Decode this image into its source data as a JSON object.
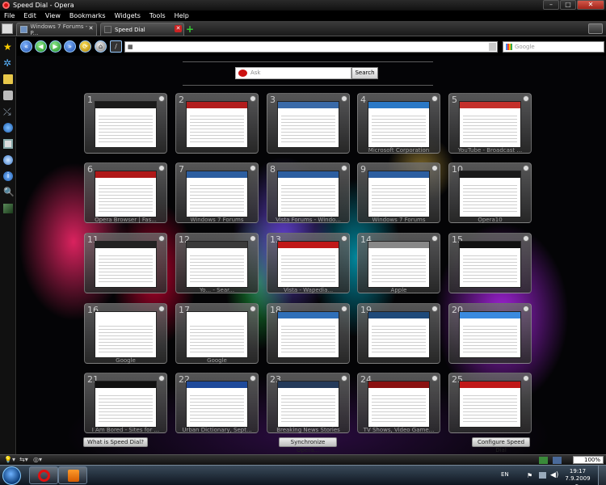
{
  "window": {
    "title": "Speed Dial - Opera"
  },
  "menu": [
    "File",
    "Edit",
    "View",
    "Bookmarks",
    "Widgets",
    "Tools",
    "Help"
  ],
  "tabs": [
    {
      "label": "Windows 7 Forums - P...",
      "active": false
    },
    {
      "label": "Speed Dial",
      "active": true
    }
  ],
  "search": {
    "engine": "Google",
    "placeholder": "Google"
  },
  "speeddial": {
    "search_placeholder": "Ask",
    "search_button": "Search",
    "dials": [
      {
        "num": "1",
        "label": "",
        "color": "#1a1a1a"
      },
      {
        "num": "2",
        "label": "",
        "color": "#b21d1d"
      },
      {
        "num": "3",
        "label": "",
        "color": "#3a6aa8"
      },
      {
        "num": "4",
        "label": "Microsoft Corporation",
        "color": "#2a78c6"
      },
      {
        "num": "5",
        "label": "YouTube - Broadcast ...",
        "color": "#c4302b"
      },
      {
        "num": "6",
        "label": "Opera Browser | Fas...",
        "color": "#b01818"
      },
      {
        "num": "7",
        "label": "Windows 7 Forums",
        "color": "#2c5ea0"
      },
      {
        "num": "8",
        "label": "Vista Forums - Windo...",
        "color": "#2c5ea0"
      },
      {
        "num": "9",
        "label": "Windows 7 Forums",
        "color": "#2c5ea0"
      },
      {
        "num": "10",
        "label": "Opera10",
        "color": "#1a1a1a"
      },
      {
        "num": "11",
        "label": "",
        "color": "#222"
      },
      {
        "num": "12",
        "label": "Yo... - Sear...",
        "color": "#3a3a3a"
      },
      {
        "num": "13",
        "label": "Vista - Wapedia...",
        "color": "#c01818"
      },
      {
        "num": "14",
        "label": "Apple",
        "color": "#888"
      },
      {
        "num": "15",
        "label": "",
        "color": "#111"
      },
      {
        "num": "16",
        "label": "Google",
        "color": "#fff"
      },
      {
        "num": "17",
        "label": "Google",
        "color": "#fff"
      },
      {
        "num": "18",
        "label": "",
        "color": "#2f6fb8"
      },
      {
        "num": "19",
        "label": "",
        "color": "#1f4a7a"
      },
      {
        "num": "20",
        "label": "",
        "color": "#3a8adf"
      },
      {
        "num": "21",
        "label": "I Am Bored - Sites for ...",
        "color": "#111"
      },
      {
        "num": "22",
        "label": "Urban Dictionary, Sept...",
        "color": "#1f4a9a"
      },
      {
        "num": "23",
        "label": "Breaking News Stories",
        "color": "#243a5a"
      },
      {
        "num": "24",
        "label": "TV Shows, Video Game...",
        "color": "#8a1111"
      },
      {
        "num": "25",
        "label": "",
        "color": "#c01818"
      }
    ],
    "bottom": {
      "what": "What is Speed Dial?",
      "sync": "Synchronize Opera...",
      "configure": "Configure Speed Dial"
    }
  },
  "status": {
    "zoom": "100%"
  },
  "taskbar": {
    "lang": "EN",
    "time": "19:17",
    "date": "7.9.2009 г."
  }
}
